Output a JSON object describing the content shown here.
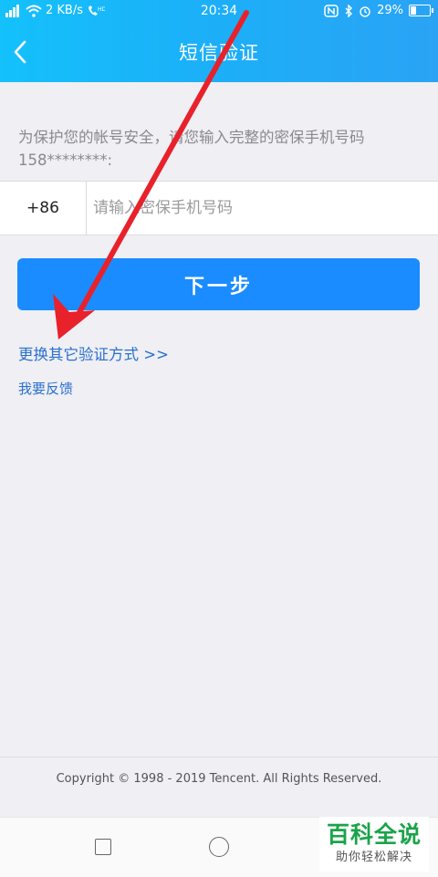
{
  "status_bar": {
    "signal": "4G",
    "speed": "2 KB/s",
    "time": "20:34",
    "battery": "29%",
    "battery_level": 0.29
  },
  "header": {
    "title": "短信验证",
    "background_color": "#1bb0f8"
  },
  "prompt": {
    "text": "为保护您的帐号安全，请您输入完整的密保手机号码158********:"
  },
  "phone": {
    "country_code": "+86",
    "placeholder": "请输入密保手机号码"
  },
  "actions": {
    "next_label": "下一步",
    "next_color": "#1a8cff",
    "switch_method_label": "更换其它验证方式 >>",
    "feedback_label": "我要反馈"
  },
  "footer": {
    "copyright": "Copyright © 1998 - 2019 Tencent. All Rights Reserved."
  },
  "watermark": {
    "title": "百科全说",
    "subtitle": "助你轻松解决"
  },
  "annotation": {
    "arrow_color": "#e8212a"
  }
}
